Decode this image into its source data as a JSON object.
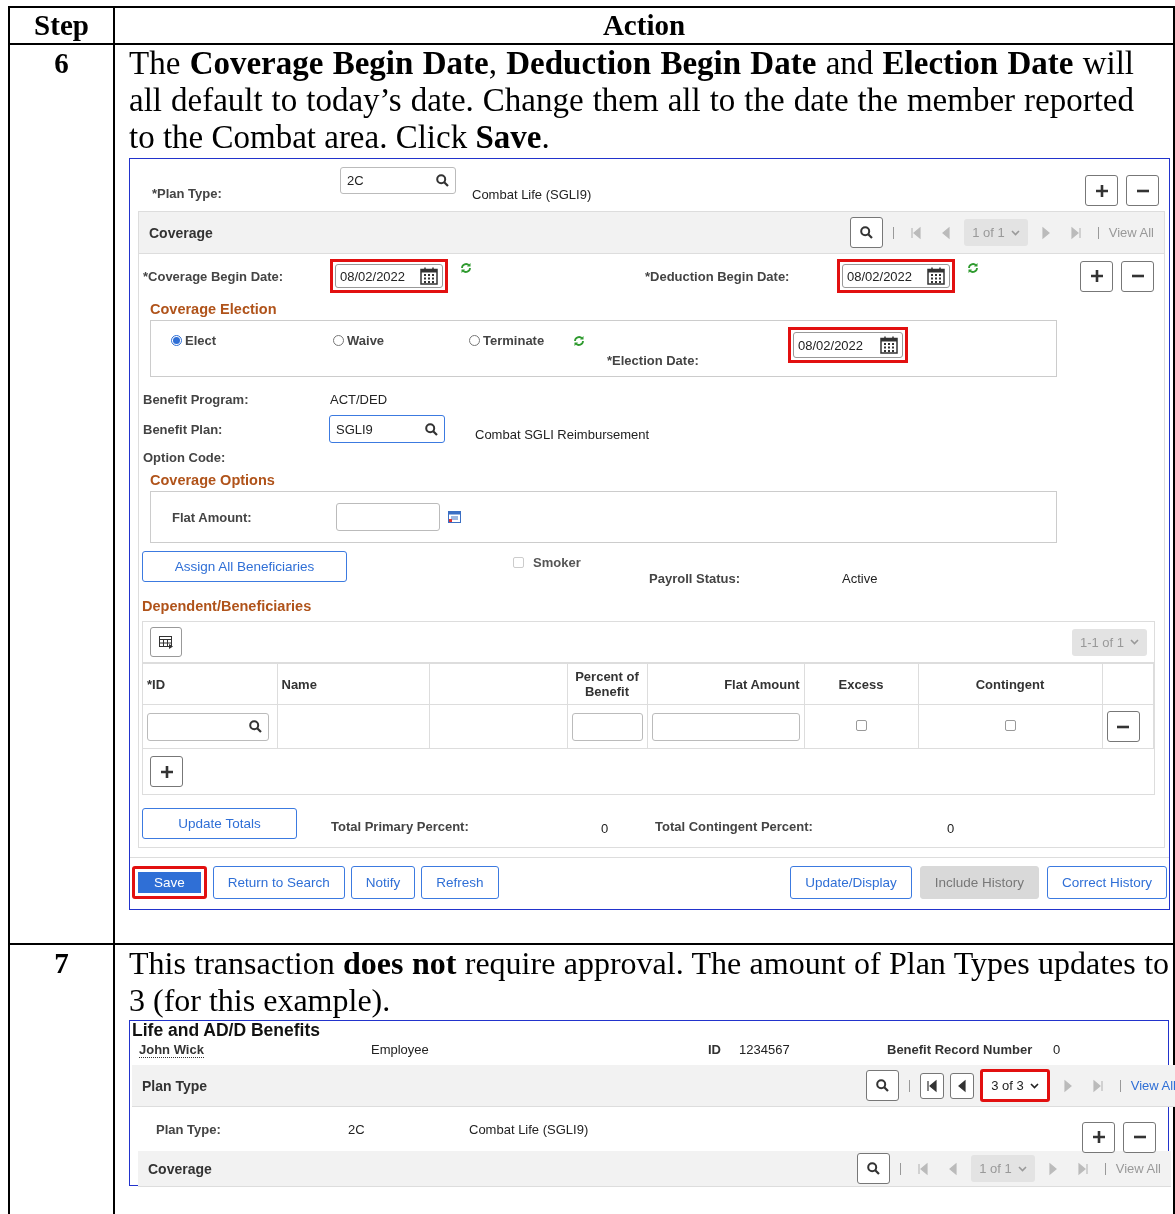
{
  "table": {
    "columns": [
      "Step",
      "Action"
    ],
    "rows": [
      {
        "step": "6",
        "instruction": "The **Coverage Begin Date**, **Deduction Begin Date** and **Election Date** will all default to today’s date. Change them all to the date the member reported to the Combat area. Click **Save**.",
        "screenshot": {
          "plan_type": {
            "label": "*Plan Type:",
            "value": "2C",
            "description": "Combat Life (SGLI9)"
          },
          "coverage": {
            "title": "Coverage",
            "pager": {
              "label": "1 of 1",
              "highlighted": false,
              "prev_enabled": false,
              "next_enabled": false
            },
            "view_all": {
              "label": "View All",
              "enabled": false
            },
            "coverage_begin_date": {
              "label": "*Coverage Begin Date:",
              "value": "08/02/2022",
              "highlighted": true
            },
            "deduction_begin_date": {
              "label": "*Deduction Begin Date:",
              "value": "08/02/2022",
              "highlighted": true
            },
            "election": {
              "title": "Coverage Election",
              "options": [
                {
                  "label": "Elect",
                  "selected": true
                },
                {
                  "label": "Waive",
                  "selected": false
                },
                {
                  "label": "Terminate",
                  "selected": false
                }
              ],
              "election_date": {
                "label": "*Election Date:",
                "value": "08/02/2022",
                "highlighted": true
              }
            },
            "benefit_program": {
              "label": "Benefit Program:",
              "value": "ACT/DED"
            },
            "benefit_plan": {
              "label": "Benefit Plan:",
              "value": "SGLI9",
              "description": "Combat SGLI Reimbursement"
            },
            "option_code": {
              "label": "Option Code:"
            },
            "coverage_options": {
              "title": "Coverage Options",
              "flat_amount": {
                "label": "Flat Amount:"
              }
            },
            "assign_button": "Assign All Beneficiaries",
            "smoker": {
              "label": "Smoker",
              "checked": false
            },
            "payroll_status": {
              "label": "Payroll Status:",
              "value": "Active"
            },
            "dependents": {
              "title": "Dependent/Beneficiaries",
              "pager": "1-1 of 1",
              "columns": [
                "*ID",
                "Name",
                "Percent of Benefit",
                "Flat Amount",
                "Excess",
                "Contingent"
              ],
              "rows": [
                {
                  "excess": false,
                  "contingent": false
                }
              ]
            },
            "update_totals": "Update Totals",
            "total_primary": {
              "label": "Total Primary Percent:",
              "value": "0"
            },
            "total_contingent": {
              "label": "Total Contingent Percent:",
              "value": "0"
            }
          },
          "buttons_left": [
            {
              "label": "Save",
              "kind": "primary",
              "highlighted": true
            },
            {
              "label": "Return to Search",
              "kind": "secondary",
              "highlighted": false
            },
            {
              "label": "Notify",
              "kind": "secondary",
              "highlighted": false
            },
            {
              "label": "Refresh",
              "kind": "secondary",
              "highlighted": false
            }
          ],
          "buttons_right": [
            {
              "label": "Update/Display",
              "kind": "secondary",
              "highlighted": false
            },
            {
              "label": "Include History",
              "kind": "disabled",
              "highlighted": false
            },
            {
              "label": "Correct History",
              "kind": "secondary",
              "highlighted": false
            }
          ]
        }
      },
      {
        "step": "7",
        "instruction": "This transaction **does not** require approval. The amount of Plan Types updates to 3 (for this example).",
        "screenshot": {
          "title": "Life and AD/D Benefits",
          "name": "John Wick",
          "role": "Employee",
          "id_label": "ID",
          "id_value": "1234567",
          "record_label": "Benefit Record Number",
          "record_value": "0",
          "plan_type_bar": {
            "title": "Plan Type",
            "pager": {
              "label": "3 of 3",
              "highlighted": true,
              "prev_enabled": true,
              "next_enabled": false
            },
            "view_all": {
              "label": "View All",
              "enabled": true
            }
          },
          "plan_type": {
            "label": "Plan Type:",
            "value": "2C",
            "description": "Combat Life (SGLI9)"
          },
          "coverage_bar": {
            "title": "Coverage",
            "pager": {
              "label": "1 of 1",
              "highlighted": false,
              "prev_enabled": false,
              "next_enabled": false
            },
            "view_all": {
              "label": "View All",
              "enabled": false
            }
          }
        }
      }
    ]
  }
}
